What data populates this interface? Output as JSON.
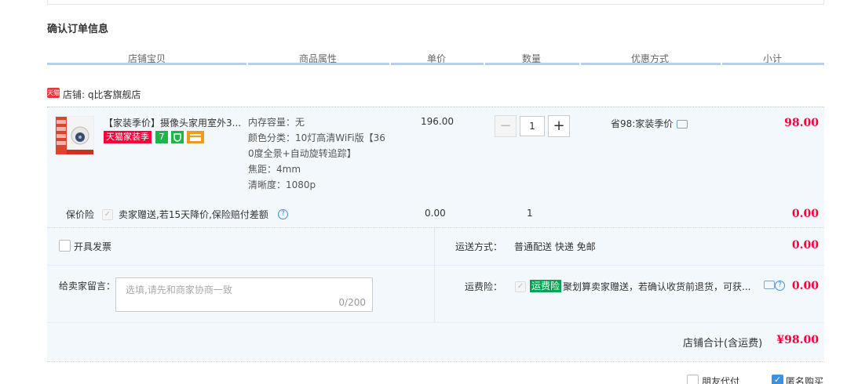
{
  "section_title": "确认订单信息",
  "columns": [
    "店铺宝贝",
    "商品属性",
    "单价",
    "数量",
    "优惠方式",
    "小计"
  ],
  "store": {
    "logo_text": "天猫",
    "name": "店铺: q比客旗舰店"
  },
  "item": {
    "title": "【家装季价】摄像头家用室外3...",
    "badge_main": "天猫家装季",
    "badge_7": "7",
    "props": [
      "内存容量：无",
      "颜色分类：10灯高清WiFi版【36",
      "0度全景+自动旋转追踪】",
      "焦距：4mm",
      "清晰度：1080p"
    ],
    "price": "196.00",
    "quantity": "1",
    "promo": "省98:家装季价",
    "subtotal": "98.00"
  },
  "insurance": {
    "label": "保价险",
    "text": "卖家赠送,若15天降价,保险赔付差额",
    "price": "0.00",
    "qty": "1",
    "subtotal": "0.00"
  },
  "invoice": {
    "label": "开具发票"
  },
  "shipping": {
    "label": "运送方式：",
    "value": "普通配送 快递 免邮",
    "price": "0.00"
  },
  "message": {
    "label": "给卖家留言：",
    "placeholder": "选填,请先和商家协商一致",
    "counter": "0/200"
  },
  "freight_insurance": {
    "label": "运费险：",
    "tag": "运费险",
    "text": "聚划算卖家赠送，若确认收货前退货，可获...",
    "price": "0.00"
  },
  "store_total": {
    "label": "店铺合计(含运费)",
    "value": "¥98.00"
  },
  "footer": {
    "friend_pay": "朋友代付",
    "anonymous": "匿名购买"
  }
}
